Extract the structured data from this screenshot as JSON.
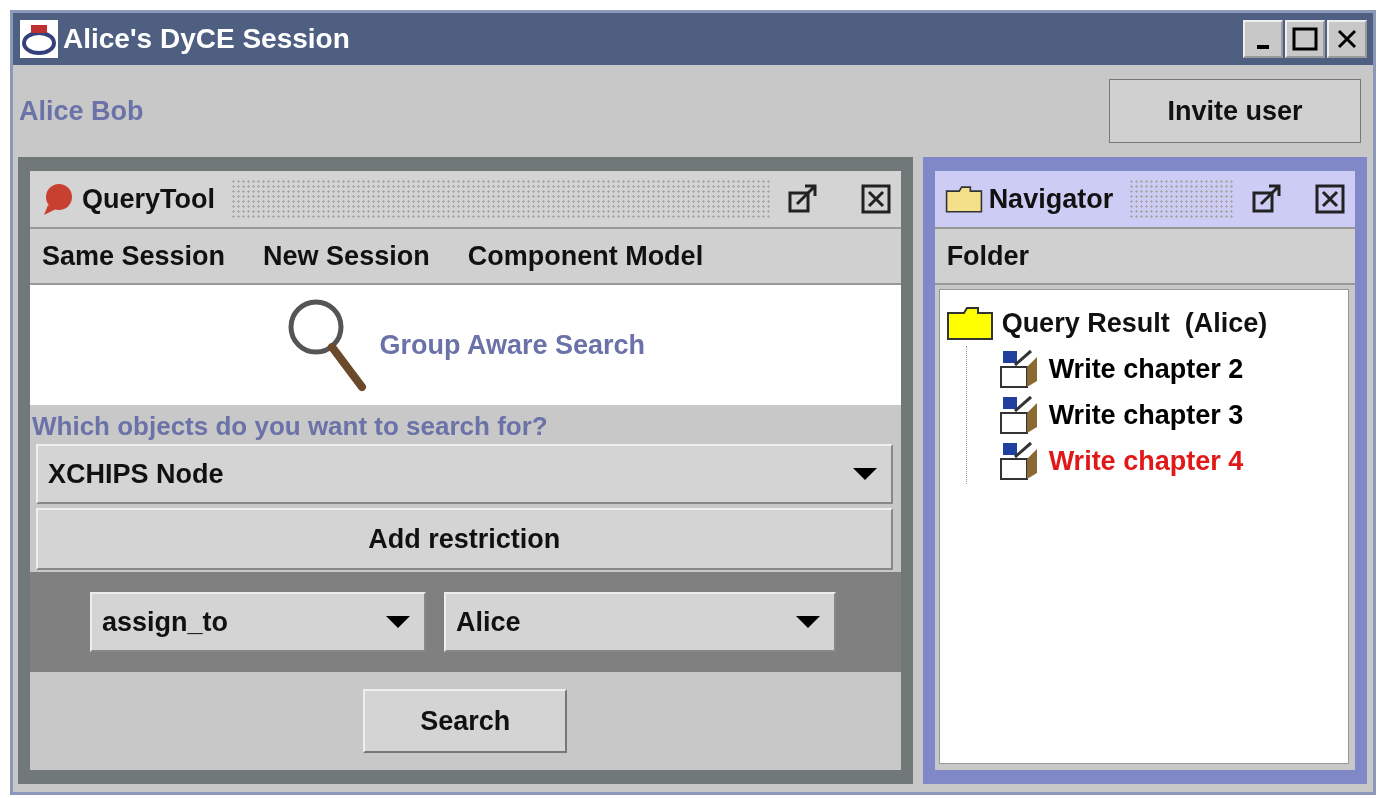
{
  "window": {
    "title": "Alice's DyCE Session"
  },
  "users": {
    "names": "Alice Bob",
    "invite_button": "Invite user"
  },
  "query_tool": {
    "title": "QueryTool",
    "active": false,
    "menu": [
      "Same Session",
      "New Session",
      "Component Model"
    ],
    "banner": "Group Aware Search",
    "question": "Which objects do you want to search for?",
    "object_type": "XCHIPS Node",
    "add_button": "Add restriction",
    "restriction": {
      "attribute": "assign_to",
      "value": "Alice"
    },
    "search_button": "Search"
  },
  "navigator": {
    "title": "Navigator",
    "active": true,
    "menu": [
      "Folder"
    ],
    "tree": [
      {
        "label": "Query Result  (Alice)",
        "children": [
          {
            "label": "Write chapter 2",
            "color": "#000000"
          },
          {
            "label": "Write chapter 3",
            "color": "#000000"
          },
          {
            "label": "Write chapter 4",
            "color": "#e01818"
          }
        ]
      }
    ]
  }
}
